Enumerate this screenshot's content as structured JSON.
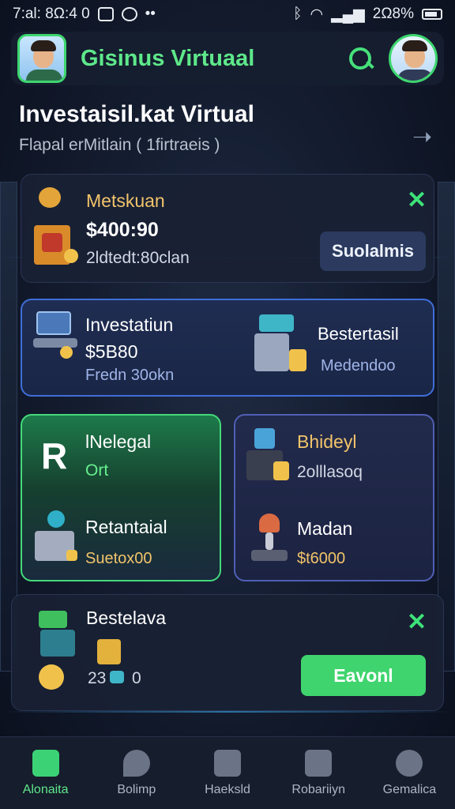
{
  "status_bar": {
    "time": "7:al: 8Ω:4 0",
    "battery": "2Ω8%"
  },
  "header": {
    "title": "Gisinus Virtuaal"
  },
  "page": {
    "title": "Investaisil.kat Virtual",
    "subtitle": "Flapal erMitlain ( 1firtraeis  )"
  },
  "card1": {
    "name": "Metskuan",
    "amount": "$400:90",
    "detail": "2ldtedt:80clan",
    "button": "Suolalmis"
  },
  "card2": {
    "left_title": "Investatiun",
    "left_amount": "$5B80",
    "left_detail": "Fredn 30okn",
    "right_title": "Bestertasil",
    "right_detail": "Medendoo"
  },
  "card3": {
    "title": "lNelegal",
    "badge": "Ort",
    "title2": "Retantaial",
    "amount2": "Suetox00"
  },
  "card4": {
    "title": "Bhideyl",
    "detail": "2olllasoq",
    "title2": "Madan",
    "amount2": "$t6000"
  },
  "card5": {
    "title": "Bestelava",
    "amount": "23",
    "suffix": "0",
    "button": "Eavonl"
  },
  "bottom_nav": [
    {
      "label": "Alonaita",
      "active": true
    },
    {
      "label": "Bolimp",
      "active": false
    },
    {
      "label": "Haeksld",
      "active": false
    },
    {
      "label": "Robariiyn",
      "active": false
    },
    {
      "label": "Gemalica",
      "active": false
    }
  ],
  "colors": {
    "accent": "#3fd46e",
    "blue_border": "#3f6ed8",
    "gold": "#f2c46a"
  }
}
